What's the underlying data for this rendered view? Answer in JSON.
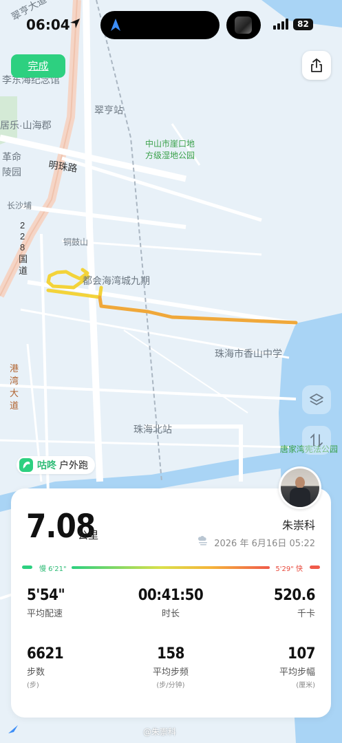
{
  "status_bar": {
    "time": "06:04",
    "battery": "82"
  },
  "buttons": {
    "done": "完成"
  },
  "map": {
    "labels": {
      "cuiheng_dadao": "翠亨大道",
      "li_donghai": "李东海纪念馆",
      "shanhai": "居乐·山海郡",
      "geming": "革命",
      "lingyuan": "陵园",
      "cuiheng_station": "翠亨站",
      "wetland_line1": "中山市崖口地",
      "wetland_line2": "方级湿地公园",
      "mingzhu_road": "明珠路",
      "changshapu": "长沙埔",
      "road_228": [
        "2",
        "2",
        "8",
        "国",
        "道"
      ],
      "tonggu": "铜鼓山",
      "haiwan": "都会海湾城九期",
      "xiangshan_school": "珠海市香山中学",
      "gangwan": [
        "港",
        "湾",
        "大",
        "道"
      ],
      "zhuhai_north": "珠海北站",
      "tangjiawan": "唐家湾宪法公园"
    }
  },
  "brand": {
    "name": "咕咚",
    "activity": "户外跑"
  },
  "summary": {
    "distance": "7.08",
    "distance_unit": "公里",
    "user_name": "朱崇科",
    "date": "2026 年 6月16日 05:22"
  },
  "pace_bar": {
    "slow_label": "慢 6'21\"",
    "fast_label": "5'29\" 快"
  },
  "stats": {
    "avg_pace": {
      "value": "5'54\"",
      "label": "平均配速"
    },
    "duration": {
      "value": "00:41:50",
      "label": "时长"
    },
    "calories": {
      "value": "520.6",
      "label": "千卡"
    },
    "steps": {
      "value": "6621",
      "label": "步数",
      "unit": "(步)"
    },
    "cadence": {
      "value": "158",
      "label": "平均步频",
      "unit": "(步/分钟)"
    },
    "stride": {
      "value": "107",
      "label": "平均步幅",
      "unit": "(厘米)"
    }
  },
  "watermark": "@朱崇科",
  "colors": {
    "accent_green": "#2dd080",
    "route_start": "#f3d33a",
    "route_end": "#f0a23a"
  }
}
